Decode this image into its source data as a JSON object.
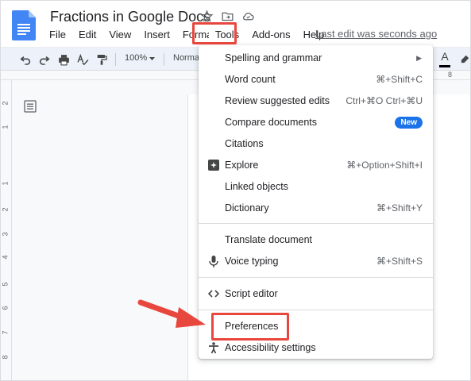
{
  "header": {
    "title": "Fractions in Google Docs",
    "last_edit": "Last edit was seconds ago"
  },
  "menubar": {
    "items": [
      "File",
      "Edit",
      "View",
      "Insert",
      "Format",
      "Tools",
      "Add-ons",
      "Help"
    ]
  },
  "toolbar": {
    "zoom": "100%",
    "style": "Normal",
    "font_color_letter": "A"
  },
  "ruler": {
    "top_label": "8",
    "left_labels": [
      "2",
      "1",
      "1",
      "2",
      "3",
      "4",
      "5",
      "6",
      "7",
      "8"
    ]
  },
  "tools_menu": {
    "items": [
      {
        "label": "Spelling and grammar",
        "shortcut": "",
        "icon": "",
        "submenu": true
      },
      {
        "label": "Word count",
        "shortcut": "⌘+Shift+C",
        "icon": ""
      },
      {
        "label": "Review suggested edits",
        "shortcut": "Ctrl+⌘O Ctrl+⌘U",
        "icon": ""
      },
      {
        "label": "Compare documents",
        "shortcut": "",
        "icon": "",
        "badge": "New"
      },
      {
        "label": "Citations",
        "shortcut": "",
        "icon": ""
      },
      {
        "label": "Explore",
        "shortcut": "⌘+Option+Shift+I",
        "icon": "explore-icon"
      },
      {
        "label": "Linked objects",
        "shortcut": "",
        "icon": ""
      },
      {
        "label": "Dictionary",
        "shortcut": "⌘+Shift+Y",
        "icon": ""
      },
      {
        "label": "Translate document",
        "shortcut": "",
        "icon": ""
      },
      {
        "label": "Voice typing",
        "shortcut": "⌘+Shift+S",
        "icon": "microphone-icon"
      },
      {
        "label": "Script editor",
        "shortcut": "",
        "icon": "code-icon"
      },
      {
        "label": "Preferences",
        "shortcut": "",
        "icon": ""
      },
      {
        "label": "Accessibility settings",
        "shortcut": "",
        "icon": "accessibility-icon"
      }
    ]
  },
  "colors": {
    "highlight": "#e8473d",
    "badge": "#1a73e8",
    "doc_icon": "#4285f4"
  }
}
